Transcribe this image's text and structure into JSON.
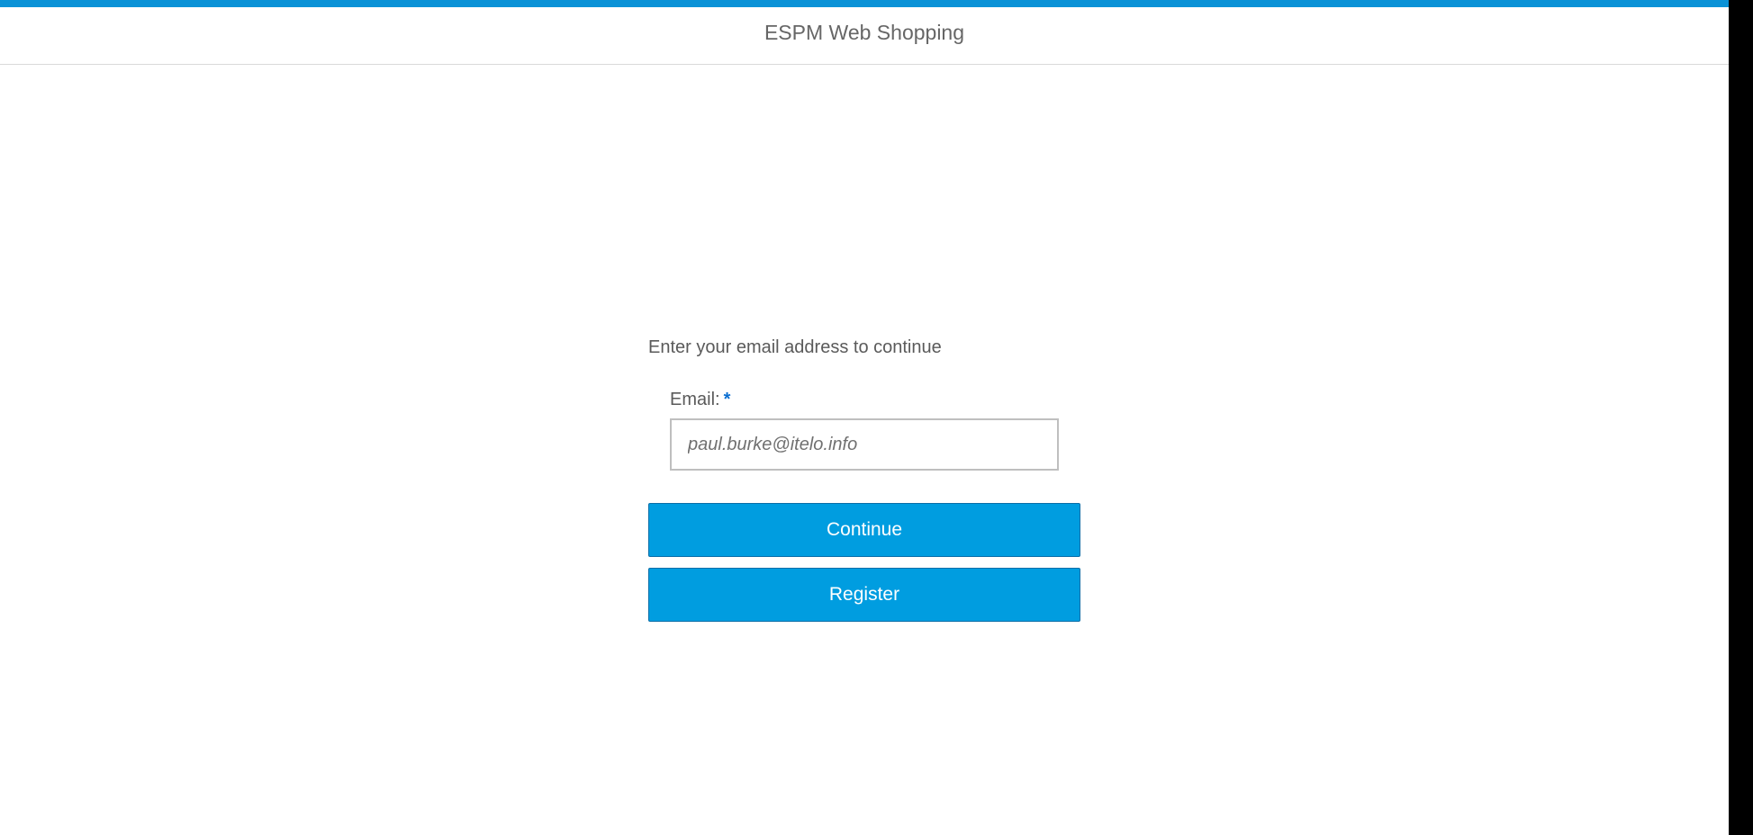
{
  "header": {
    "title": "ESPM Web Shopping"
  },
  "login": {
    "prompt": "Enter your email address to continue",
    "email_label": "Email:",
    "required_marker": "*",
    "email_value": "paul.burke@itelo.info",
    "continue_label": "Continue",
    "register_label": "Register"
  },
  "colors": {
    "accent": "#0a92d7",
    "button": "#009de0",
    "required": "#0a6ed1"
  }
}
